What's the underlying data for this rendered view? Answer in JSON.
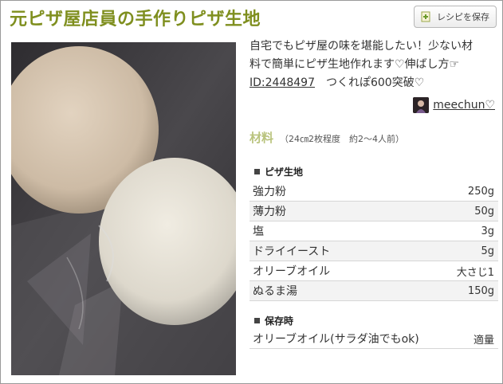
{
  "recipe": {
    "title": "元ピザ屋店員の手作りピザ生地",
    "save_label": "レシピを保存",
    "description_line1": "自宅でもピザ屋の味を堪能したい！少ない材",
    "description_line2": "料で簡単にピザ生地作れます♡伸ばし方☞",
    "recipe_id": "ID:2448497",
    "description_tail": "　つくれぽ600突破♡",
    "author": "meechun♡"
  },
  "ingredients": {
    "title": "材料",
    "servings": "（24㎝2枚程度　約2〜4人前）",
    "sections": [
      {
        "name": "ピザ生地",
        "items": [
          {
            "name": "強力粉",
            "amount": "250g"
          },
          {
            "name": "薄力粉",
            "amount": "50g"
          },
          {
            "name": "塩",
            "amount": "3g"
          },
          {
            "name": "ドライイースト",
            "amount": "5g"
          },
          {
            "name": "オリーブオイル",
            "amount": "大さじ1"
          },
          {
            "name": "ぬるま湯",
            "amount": "150g"
          }
        ]
      },
      {
        "name": "保存時",
        "items": [
          {
            "name": "オリーブオイル(サラダ油でもok)",
            "amount": "適量"
          }
        ]
      }
    ]
  },
  "icons": {
    "save": "bookmark-plus-icon",
    "section_marker": "square-bullet-icon"
  },
  "colors": {
    "title": "#7f8f1f",
    "ingredients_title": "#b9c37d",
    "row_shade": "#f3f3f3"
  }
}
